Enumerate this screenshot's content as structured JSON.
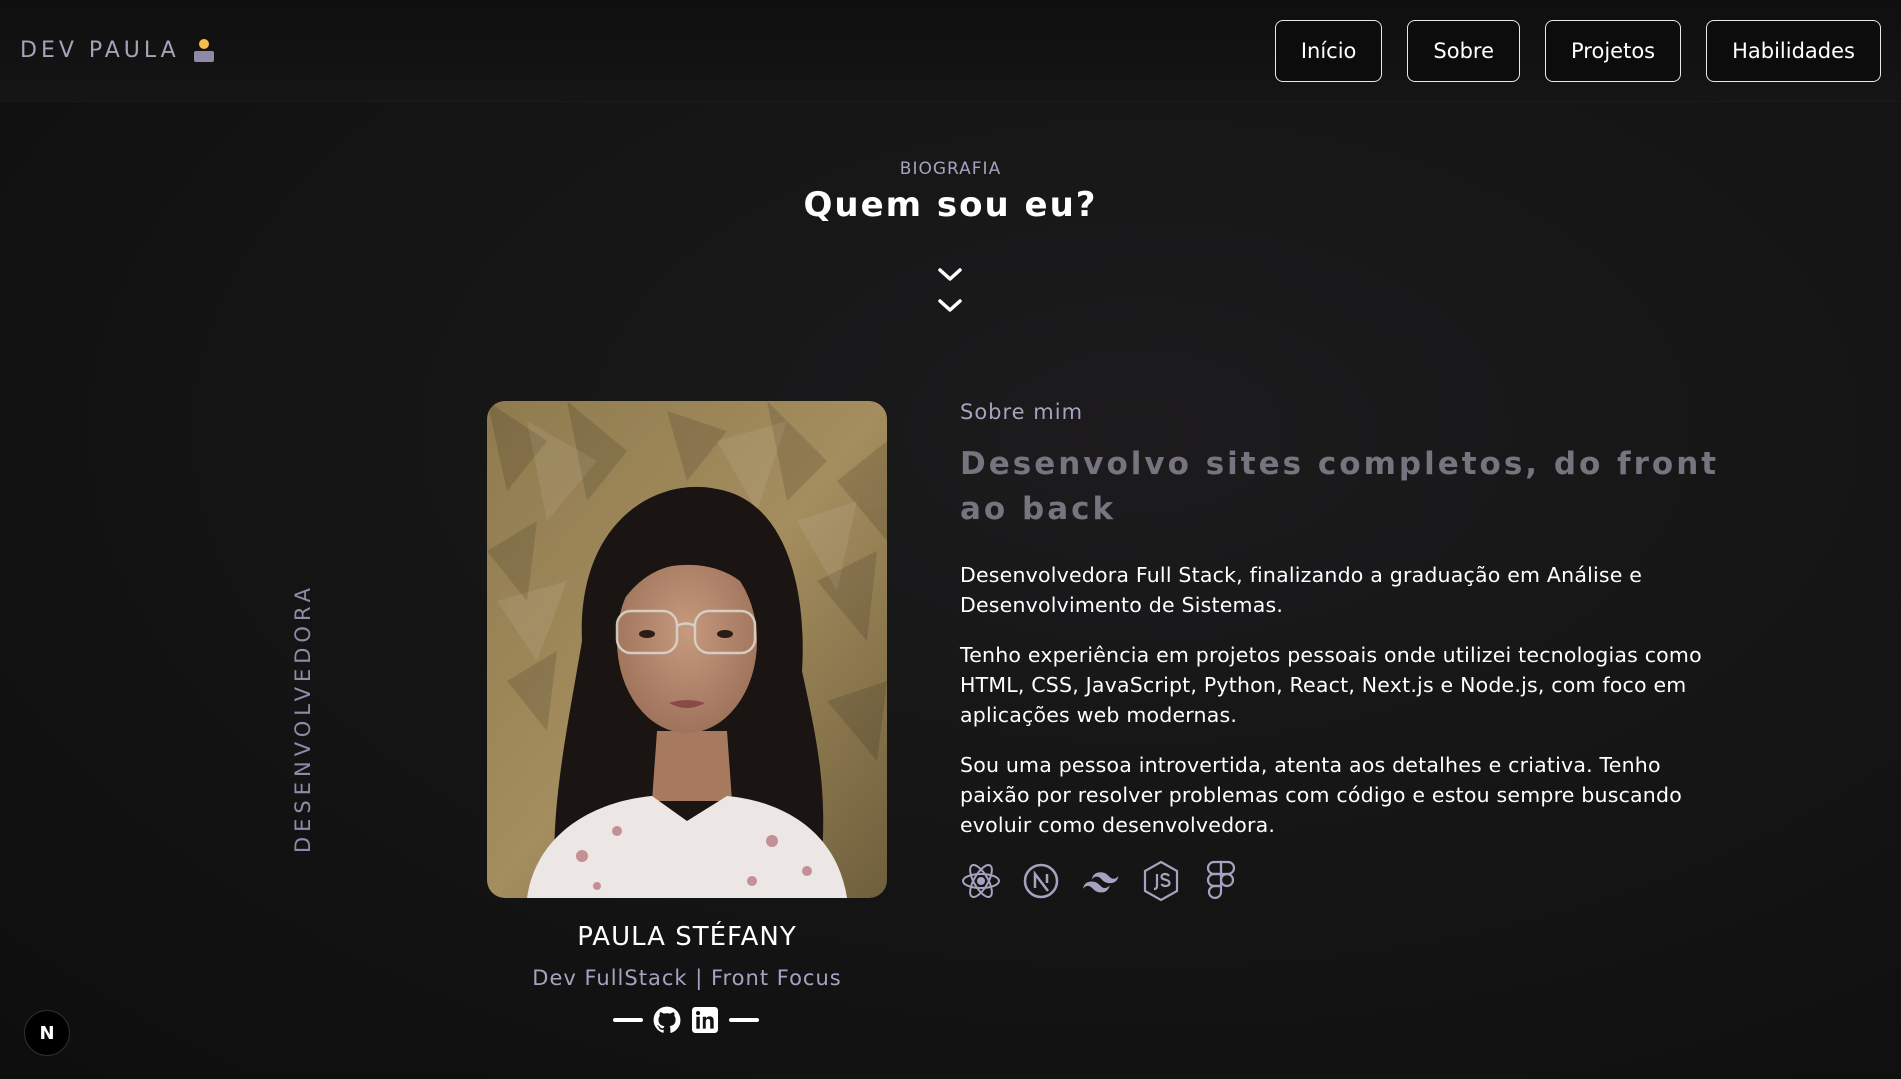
{
  "header": {
    "brand": "DEV PAULA",
    "brand_icon": "technologist-emoji-icon",
    "nav": [
      {
        "label": "Início"
      },
      {
        "label": "Sobre"
      },
      {
        "label": "Projetos"
      },
      {
        "label": "Habilidades"
      }
    ]
  },
  "section": {
    "eyebrow": "BIOGRAFIA",
    "title": "Quem sou eu?",
    "scroll_icon": "double-chevron-down-icon"
  },
  "side_label": "DESENVOLVEDORA",
  "profile": {
    "name": "PAULA STÉFANY",
    "role": "Dev FullStack | Front Focus",
    "socials": [
      {
        "icon": "github-icon"
      },
      {
        "icon": "linkedin-icon"
      }
    ]
  },
  "about": {
    "label": "Sobre mim",
    "headline": "Desenvolvo sites completos, do front ao back",
    "paragraphs": [
      "Desenvolvedora Full Stack, finalizando a graduação em Análise e Desenvolvimento de Sistemas.",
      "Tenho experiência em projetos pessoais onde utilizei tecnologias como HTML, CSS, JavaScript, Python, React, Next.js e Node.js, com foco em aplicações web modernas.",
      "Sou uma pessoa introvertida, atenta aos detalhes e criativa. Tenho paixão por resolver problemas com código e estou sempre buscando evoluir como desenvolvedora."
    ],
    "tech_icons": [
      "react-icon",
      "nextjs-icon",
      "tailwind-icon",
      "nodejs-icon",
      "figma-icon"
    ]
  },
  "next_badge": "N",
  "colors": {
    "accent_muted": "#a7a2bf",
    "headline_gray": "#77737f",
    "background": "#121212"
  }
}
